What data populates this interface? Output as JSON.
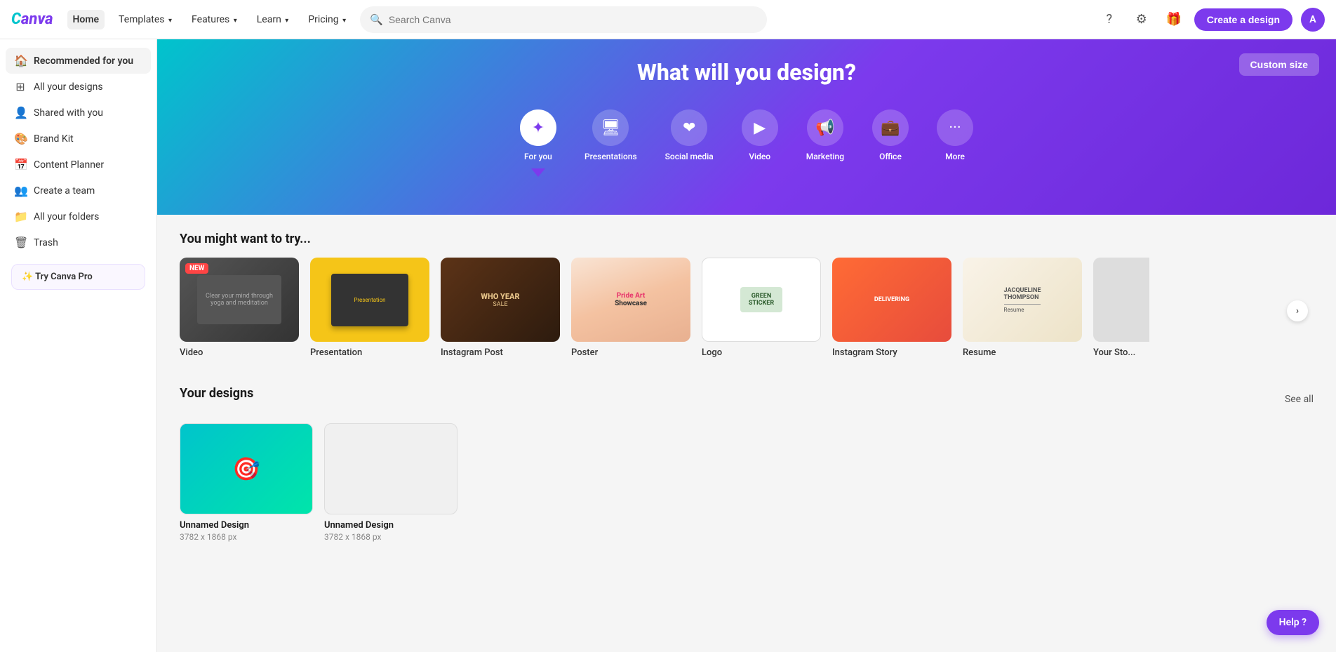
{
  "brand": {
    "logo_text": "Canva",
    "logo_color_1": "#7c3aed",
    "logo_color_2": "#00c4cc"
  },
  "topbar": {
    "home_label": "Home",
    "nav_items": [
      {
        "label": "Templates",
        "has_chevron": true
      },
      {
        "label": "Features",
        "has_chevron": true
      },
      {
        "label": "Learn",
        "has_chevron": true
      },
      {
        "label": "Pricing",
        "has_chevron": true
      }
    ],
    "search_placeholder": "Search Canva",
    "create_btn_label": "Create a design",
    "avatar_letter": "A"
  },
  "sidebar": {
    "items": [
      {
        "label": "Recommended for you",
        "icon": "🏠",
        "active": true
      },
      {
        "label": "All your designs",
        "icon": "🗂"
      },
      {
        "label": "Shared with you",
        "icon": "👤"
      },
      {
        "label": "Brand Kit",
        "icon": "🎨"
      },
      {
        "label": "Content Planner",
        "icon": "📅"
      },
      {
        "label": "Create a team",
        "icon": "👥"
      },
      {
        "label": "All your folders",
        "icon": "📁"
      },
      {
        "label": "Trash",
        "icon": "🗑"
      }
    ],
    "try_pro_label": "✨ Try Canva Pro"
  },
  "hero": {
    "title": "What will you design?",
    "custom_size_label": "Custom size",
    "categories": [
      {
        "label": "For you",
        "icon": "✦",
        "active": true
      },
      {
        "label": "Presentations",
        "icon": "🖥"
      },
      {
        "label": "Social media",
        "icon": "❤"
      },
      {
        "label": "Video",
        "icon": "▶"
      },
      {
        "label": "Marketing",
        "icon": "📢"
      },
      {
        "label": "Office",
        "icon": "💼"
      },
      {
        "label": "More",
        "icon": "···"
      }
    ]
  },
  "try_section": {
    "title": "You might want to try...",
    "templates": [
      {
        "label": "Video",
        "badge": "NEW",
        "color": "#444"
      },
      {
        "label": "Presentation",
        "color": "#f5c518"
      },
      {
        "label": "Instagram Post",
        "color": "#5c3317"
      },
      {
        "label": "Poster",
        "color": "#f4c2a1"
      },
      {
        "label": "Logo",
        "color": "#fff"
      },
      {
        "label": "Instagram Story",
        "color": "#e74c3c"
      },
      {
        "label": "Resume",
        "color": "#ede3c8"
      },
      {
        "label": "Your Sto...",
        "color": "#ddd"
      }
    ]
  },
  "designs_section": {
    "title": "Your designs",
    "see_all_label": "See all",
    "designs": [
      {
        "name": "Unnamed Design",
        "size": "3782 x 1868 px",
        "has_thumb": true
      },
      {
        "name": "Unnamed Design",
        "size": "3782 x 1868 px",
        "has_thumb": false
      }
    ]
  },
  "help_btn": {
    "label": "Help ?"
  }
}
